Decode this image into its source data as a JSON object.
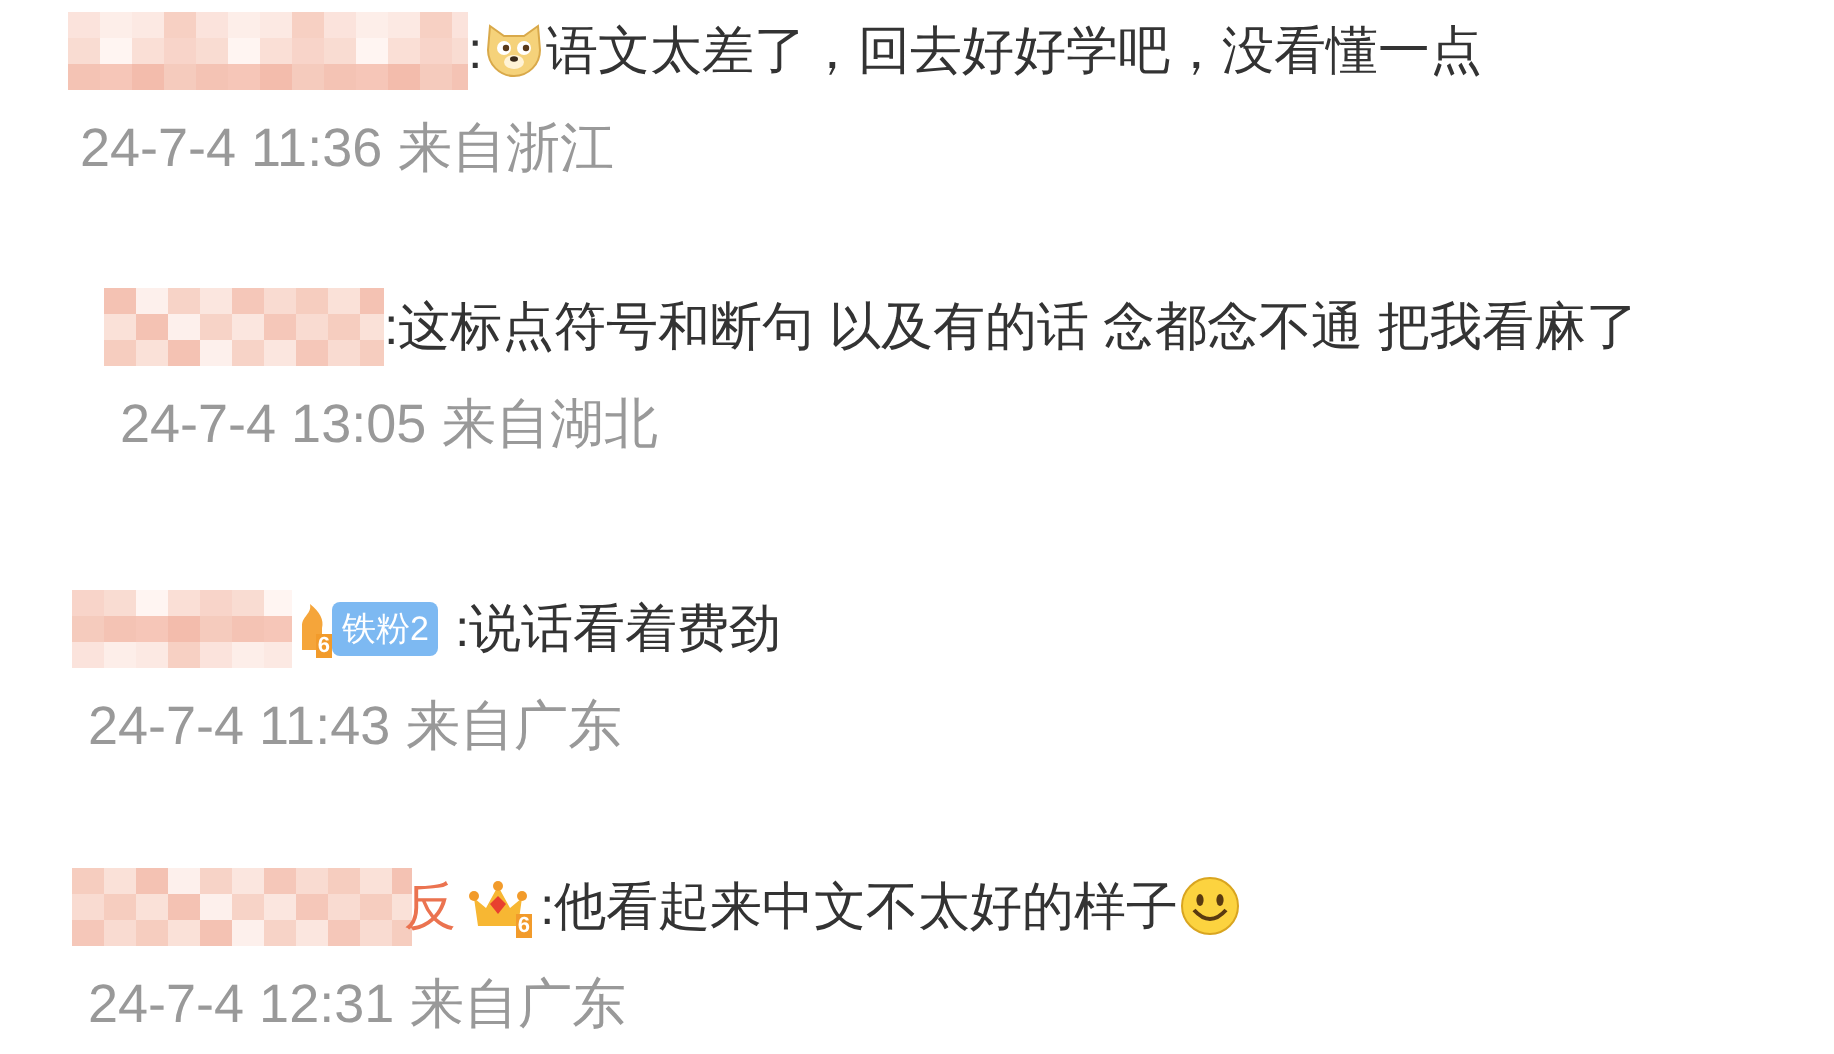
{
  "comments": [
    {
      "segments": [
        {
          "kind": "text",
          "text": ":"
        },
        {
          "kind": "doge"
        },
        {
          "kind": "text",
          "text": "语文太差了，回去好好学吧，没看懂一点"
        }
      ],
      "time": "24-7-4 11:36",
      "region": "来自浙江"
    },
    {
      "segments": [
        {
          "kind": "text",
          "text": ":这标点符号和断句 以及有的话 念都念不通 把我看麻了"
        }
      ],
      "time": "24-7-4 13:05",
      "region": "来自湖北"
    },
    {
      "badges": [
        {
          "kind": "fan",
          "mark": "6",
          "label": "铁粉2"
        }
      ],
      "segments": [
        {
          "kind": "text",
          "text": ":说话看着费劲"
        }
      ],
      "time": "24-7-4 11:43",
      "region": "来自广东"
    },
    {
      "name_suffix": "反",
      "badges": [
        {
          "kind": "crown",
          "mark": "6"
        }
      ],
      "segments": [
        {
          "kind": "text",
          "text": ":他看起来中文不太好的样子"
        },
        {
          "kind": "smile"
        }
      ],
      "time": "24-7-4 12:31",
      "region": "来自广东"
    }
  ]
}
